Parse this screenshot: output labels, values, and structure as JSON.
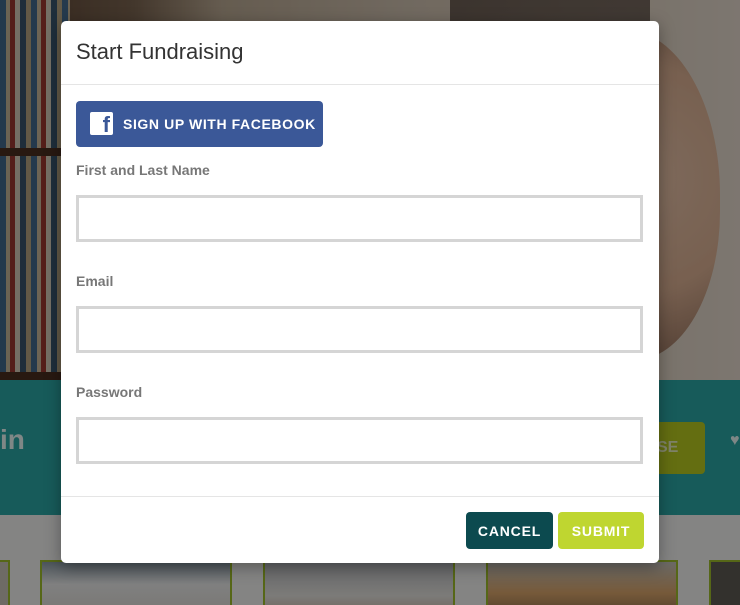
{
  "background": {
    "band_text": "in",
    "band_button_label": "SE",
    "colors": {
      "teal_band": "#2aa6a4",
      "lime_accent": "#b6c81f",
      "thumb_border": "#9dbc2a"
    }
  },
  "modal": {
    "title": "Start Fundraising",
    "facebook_button": {
      "label": "SIGN UP WITH FACEBOOK",
      "icon": "facebook-icon",
      "color": "#3b5898"
    },
    "fields": {
      "name": {
        "label": "First and Last Name",
        "value": "",
        "placeholder": ""
      },
      "email": {
        "label": "Email",
        "value": "",
        "placeholder": ""
      },
      "password": {
        "label": "Password",
        "value": "",
        "placeholder": ""
      }
    },
    "footer": {
      "cancel_label": "CANCEL",
      "submit_label": "SUBMIT",
      "cancel_color": "#0c4a4f",
      "submit_color": "#bfd630"
    }
  }
}
